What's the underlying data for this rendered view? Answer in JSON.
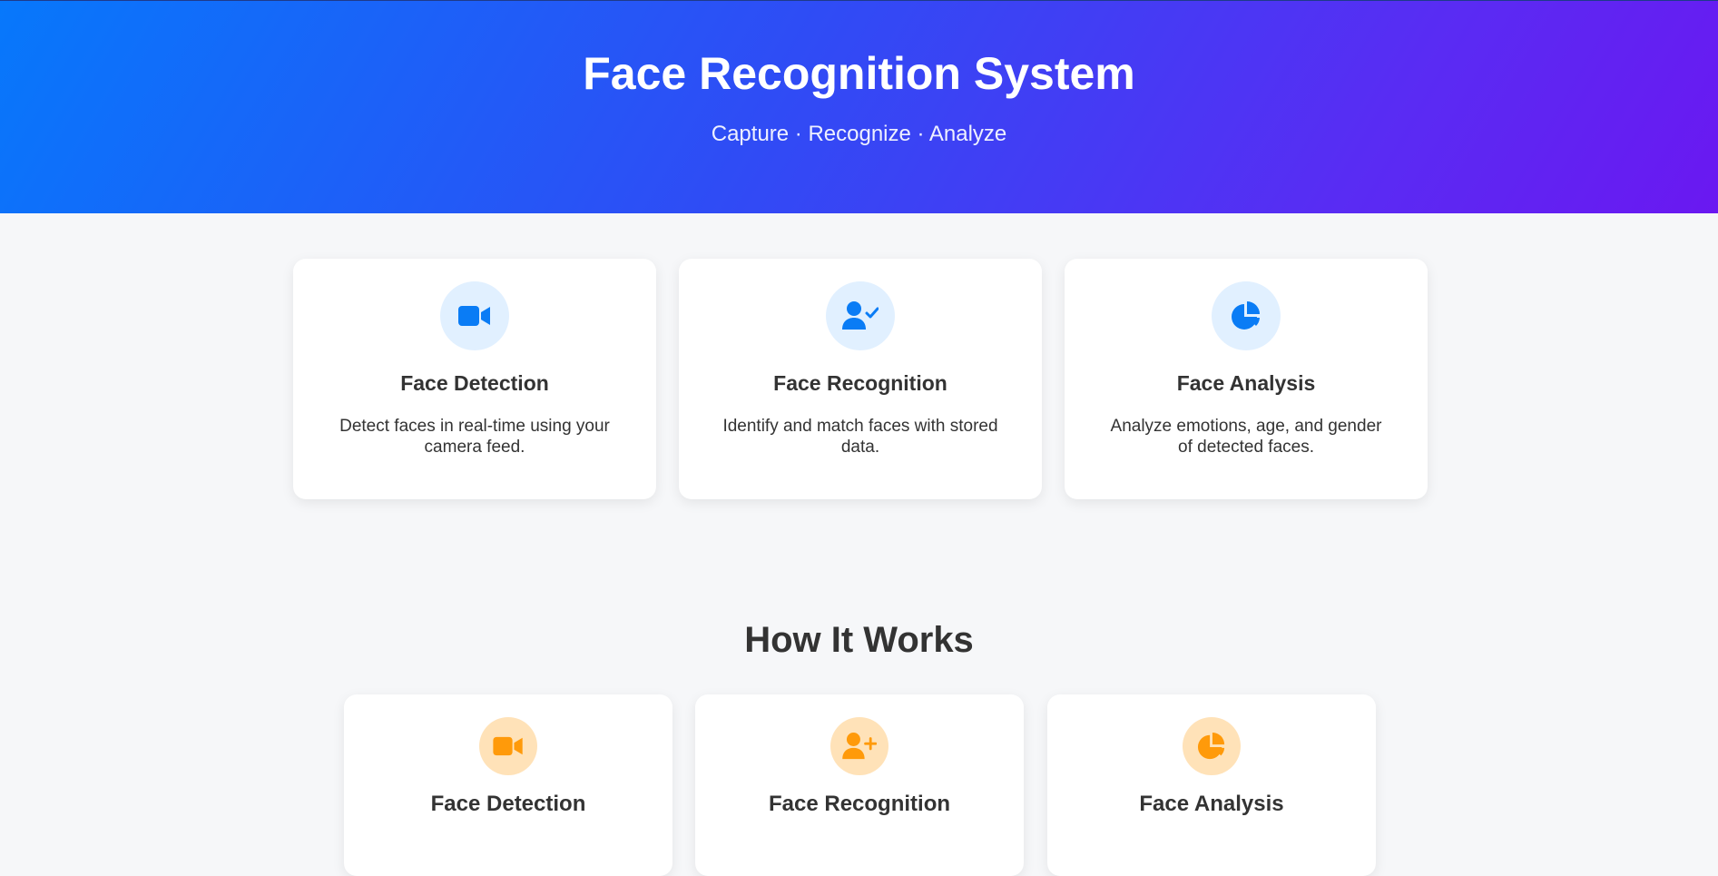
{
  "hero": {
    "title": "Face Recognition System",
    "subtitle": "Capture · Recognize · Analyze",
    "gradient_colors": [
      "#0778fb",
      "#6a18f1"
    ]
  },
  "features": [
    {
      "icon": "video-camera-icon",
      "title": "Face Detection",
      "description": "Detect faces in real-time using your camera feed."
    },
    {
      "icon": "user-check-icon",
      "title": "Face Recognition",
      "description": "Identify and match faces with stored data."
    },
    {
      "icon": "pie-chart-icon",
      "title": "Face Analysis",
      "description": "Analyze emotions, age, and gender of detected faces."
    }
  ],
  "how_it_works": {
    "title": "How It Works",
    "steps": [
      {
        "icon": "video-camera-icon",
        "title": "Face Detection"
      },
      {
        "icon": "user-plus-icon",
        "title": "Face Recognition"
      },
      {
        "icon": "pie-chart-icon",
        "title": "Face Analysis"
      }
    ]
  },
  "colors": {
    "accent_blue": "#0a7cf5",
    "accent_orange": "#ff9a0a",
    "background": "#f6f7f9",
    "text": "#333333"
  }
}
